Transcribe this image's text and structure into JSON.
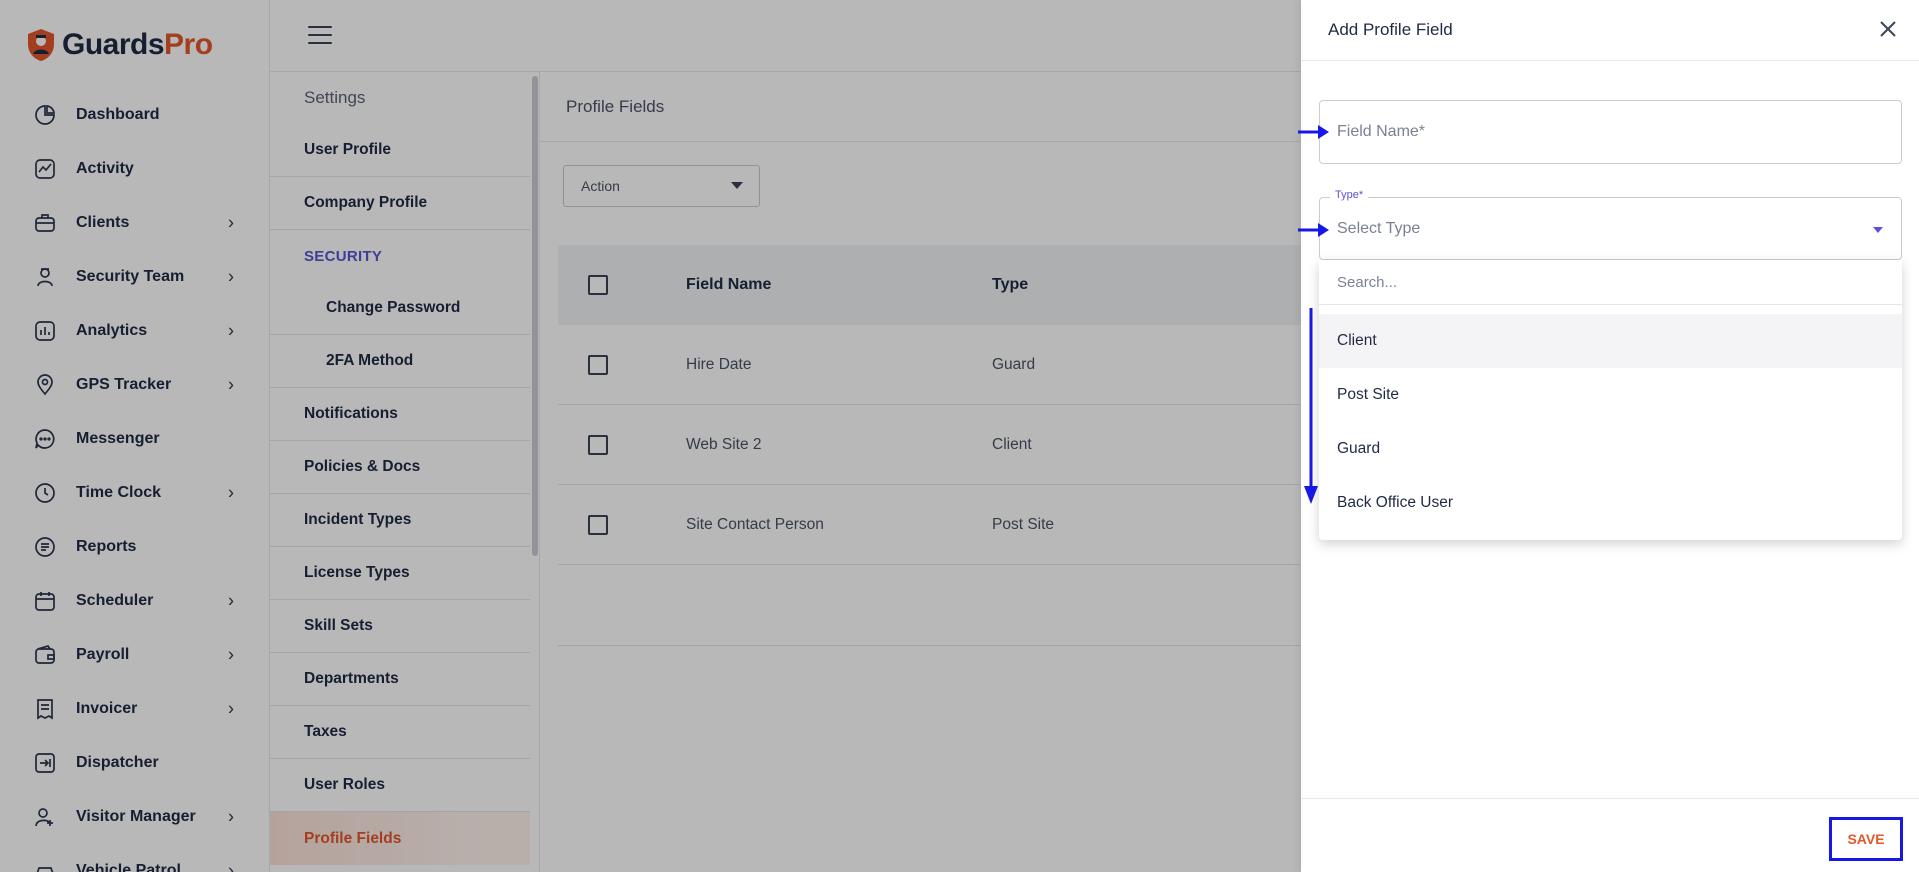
{
  "brand": {
    "name_part1": "Guards",
    "name_part2": "Pro"
  },
  "nav": [
    {
      "label": "Dashboard",
      "icon": "dashboard-icon",
      "chevron": false
    },
    {
      "label": "Activity",
      "icon": "activity-icon",
      "chevron": false
    },
    {
      "label": "Clients",
      "icon": "briefcase-icon",
      "chevron": true
    },
    {
      "label": "Security Team",
      "icon": "guard-icon",
      "chevron": true
    },
    {
      "label": "Analytics",
      "icon": "analytics-icon",
      "chevron": true
    },
    {
      "label": "GPS Tracker",
      "icon": "location-pin-icon",
      "chevron": true
    },
    {
      "label": "Messenger",
      "icon": "chat-icon",
      "chevron": false
    },
    {
      "label": "Time Clock",
      "icon": "clock-icon",
      "chevron": true
    },
    {
      "label": "Reports",
      "icon": "reports-icon",
      "chevron": false
    },
    {
      "label": "Scheduler",
      "icon": "calendar-icon",
      "chevron": true
    },
    {
      "label": "Payroll",
      "icon": "wallet-icon",
      "chevron": true
    },
    {
      "label": "Invoicer",
      "icon": "receipt-icon",
      "chevron": true
    },
    {
      "label": "Dispatcher",
      "icon": "dispatch-icon",
      "chevron": false
    },
    {
      "label": "Visitor Manager",
      "icon": "visitor-icon",
      "chevron": true
    },
    {
      "label": "Vehicle Patrol",
      "icon": "car-icon",
      "chevron": true
    }
  ],
  "settings": {
    "title": "Settings",
    "items_top": [
      "User Profile",
      "Company Profile"
    ],
    "security_label": "SECURITY",
    "security_items": [
      "Change Password",
      "2FA Method"
    ],
    "items_bottom": [
      "Notifications",
      "Policies & Docs",
      "Incident Types",
      "License Types",
      "Skill Sets",
      "Departments",
      "Taxes",
      "User Roles"
    ],
    "active_item": "Profile Fields"
  },
  "main": {
    "title": "Profile Fields",
    "action_label": "Action",
    "columns": {
      "name": "Field Name",
      "type": "Type"
    },
    "rows": [
      {
        "name": "Hire Date",
        "type": "Guard"
      },
      {
        "name": "Web Site 2",
        "type": "Client"
      },
      {
        "name": "Site Contact Person",
        "type": "Post Site"
      }
    ]
  },
  "drawer": {
    "title": "Add Profile Field",
    "field_name_placeholder": "Field Name*",
    "type_legend": "Type*",
    "type_placeholder": "Select Type",
    "search_placeholder": "Search...",
    "options": [
      "Client",
      "Post Site",
      "Guard",
      "Back Office User"
    ],
    "save_label": "SAVE"
  },
  "colors": {
    "brand_orange": "#e2572c",
    "accent_purple": "#5b52d6",
    "annotation_blue": "#1818e6"
  }
}
